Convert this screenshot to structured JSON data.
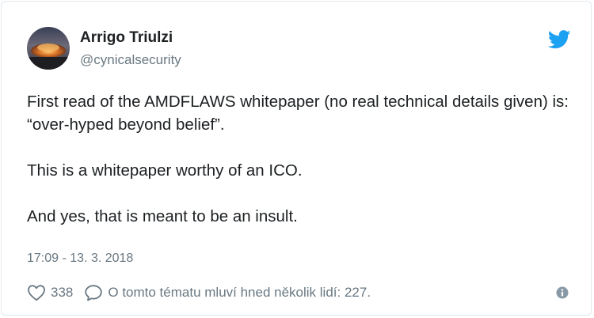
{
  "author": {
    "name": "Arrigo Triulzi",
    "handle": "@cynicalsecurity",
    "avatar_icon": "avatar-image"
  },
  "tweet": {
    "lines": [
      "First read of the AMDFLAWS whitepaper (no real technical details given) is: “over-hyped beyond belief”.",
      "This is a whitepaper worthy of an ICO.",
      "And yes, that is meant to be an insult."
    ],
    "timestamp": "17:09 - 13. 3. 2018"
  },
  "actions": {
    "like_count": "338",
    "like_icon": "heart-icon",
    "talk_icon": "speech-bubble-icon",
    "talk_text": "O tomto tématu mluví hned několik lidí: 227.",
    "info_icon": "info-icon"
  },
  "colors": {
    "brand": "#1da1f2",
    "text": "#1c2022",
    "muted": "#697882",
    "border": "#e1e8ed"
  }
}
